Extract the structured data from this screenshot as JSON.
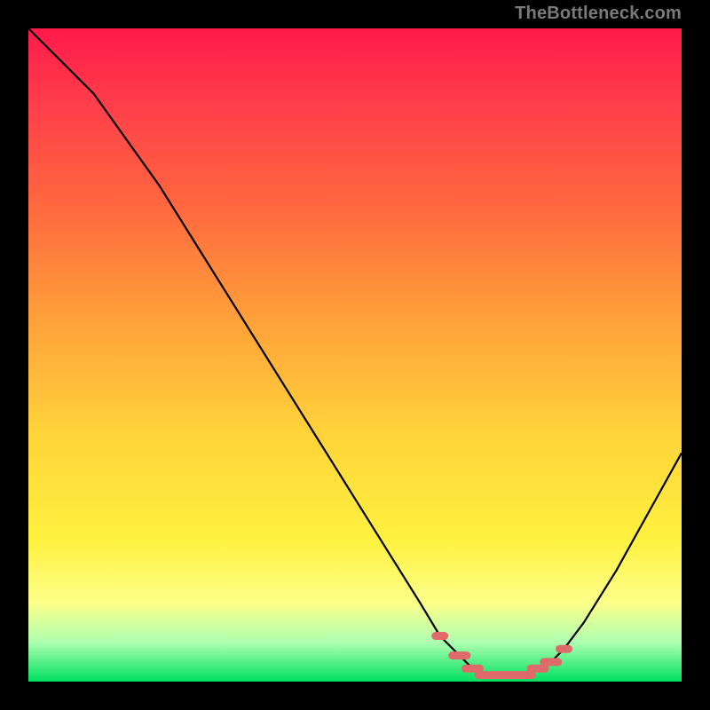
{
  "watermark": "TheBottleneck.com",
  "colors": {
    "gradient_top": "#ff1a4b",
    "gradient_mid1": "#ff6a3e",
    "gradient_mid2": "#ffd33a",
    "gradient_mid3": "#fcff8a",
    "gradient_bottom": "#00e060",
    "curve": "#000000",
    "markers": "#e06a6a",
    "frame": "#000000"
  },
  "chart_data": {
    "type": "line",
    "title": "",
    "xlabel": "",
    "ylabel": "",
    "xlim": [
      0,
      100
    ],
    "ylim": [
      0,
      100
    ],
    "grid": false,
    "series": [
      {
        "name": "bottleneck-curve",
        "x": [
          0,
          5,
          10,
          15,
          20,
          25,
          30,
          35,
          40,
          45,
          50,
          55,
          60,
          63,
          66,
          68,
          70,
          72,
          74,
          76,
          78,
          80,
          82,
          85,
          90,
          95,
          100
        ],
        "values": [
          100,
          95,
          90,
          83,
          76,
          68,
          60,
          52,
          44,
          36,
          28,
          20,
          12,
          7,
          4,
          2,
          1,
          1,
          1,
          1,
          2,
          3,
          5,
          9,
          17,
          26,
          35
        ]
      }
    ],
    "markers": {
      "name": "optimal-zone-markers",
      "x": [
        63,
        66,
        68,
        70,
        72,
        74,
        76,
        78,
        80,
        82
      ],
      "values": [
        7,
        4,
        2,
        1,
        1,
        1,
        1,
        2,
        3,
        5
      ]
    },
    "legend": null
  }
}
